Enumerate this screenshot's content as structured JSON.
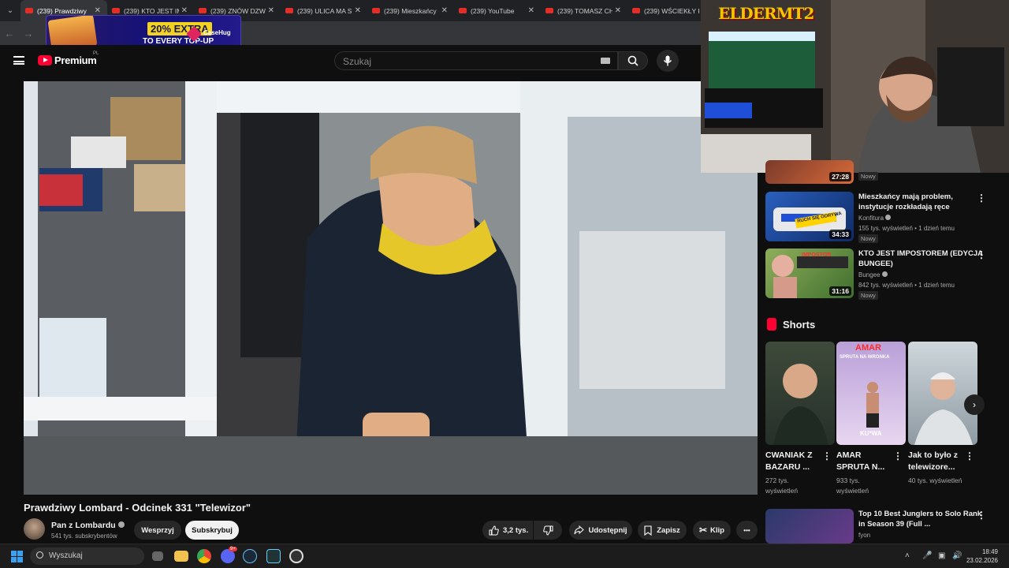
{
  "browser": {
    "tabs": [
      {
        "title": "(239) Prawdziwy"
      },
      {
        "title": "(239) KTO JEST IM"
      },
      {
        "title": "(239) ZNÓW DZW"
      },
      {
        "title": "(239) ULICA MA S"
      },
      {
        "title": "(239) Mieszkańcy"
      },
      {
        "title": "(239) YouTube"
      },
      {
        "title": "(239) TOMASZ CH"
      },
      {
        "title": "(239) WŚCIEKŁY P"
      }
    ],
    "tab_close": "✕",
    "tab_menu_icon": "⌄"
  },
  "promo": {
    "percent": "20% EXTRA",
    "subtitle": "TO EVERY TOP-UP",
    "brand": "CaseHug"
  },
  "youtube": {
    "logo_text": "Premium",
    "region": "PL",
    "search_placeholder": "Szukaj"
  },
  "webcam": {
    "overlay_logo": "ELDERMT2"
  },
  "video": {
    "title": "Prawdziwy Lombard - Odcinek 331 \"Telewizor\"",
    "channel": "Pan z Lombardu",
    "subscribers": "541 tys. subskrybentów",
    "join_label": "Wesprzyj",
    "subscribe_label": "Subskrybuj",
    "likes": "3,2 tys.",
    "share_label": "Udostępnij",
    "save_label": "Zapisz",
    "clip_label": "Klip",
    "more_label": "•••"
  },
  "sidebar": {
    "partial_item": {
      "duration": "27:28",
      "badge": "Nowy"
    },
    "items": [
      {
        "title": "Mieszkańcy mają problem, instytucje rozkładają ręce",
        "channel": "Konfitura",
        "meta": "155 tys. wyświetleń • 1 dzień temu",
        "badge": "Nowy",
        "duration": "34:33"
      },
      {
        "title": "KTO JEST IMPOSTOREM (EDYCJA BUNGEE)",
        "channel": "Bungee",
        "meta": "842 tys. wyświetleń • 1 dzień temu",
        "badge": "Nowy",
        "duration": "31:16"
      },
      {
        "title": "Top 10 Best Junglers to Solo Rank in Season 39 (Full ...",
        "channel": "fyon"
      }
    ],
    "shorts_label": "Shorts",
    "shorts": [
      {
        "title": "CWANIAK Z BAZARU ...",
        "views": "272 tys. wyświetleń"
      },
      {
        "title": "AMAR SPRUTA N...",
        "views": "933 tys. wyświetleń",
        "thumb_caption_top": "AMAR",
        "thumb_caption_sub": "SPRUTA NA WRONKA",
        "thumb_caption_bottom": "KU*WA"
      },
      {
        "title": "Jak to było z telewizore...",
        "views": "40 tys. wyświetleń"
      }
    ],
    "thumb_text_1": "RUCH SIĘ ODRYWA",
    "thumb_text_2": "IMPOSTOR"
  },
  "taskbar": {
    "search_label": "Wyszukaj",
    "time": "18:49",
    "date": "23.02.2026",
    "badge": "9+"
  },
  "colors": {
    "accent_red": "#ff0033",
    "background": "#0f0f0f",
    "promo_yellow": "#f2d320"
  }
}
